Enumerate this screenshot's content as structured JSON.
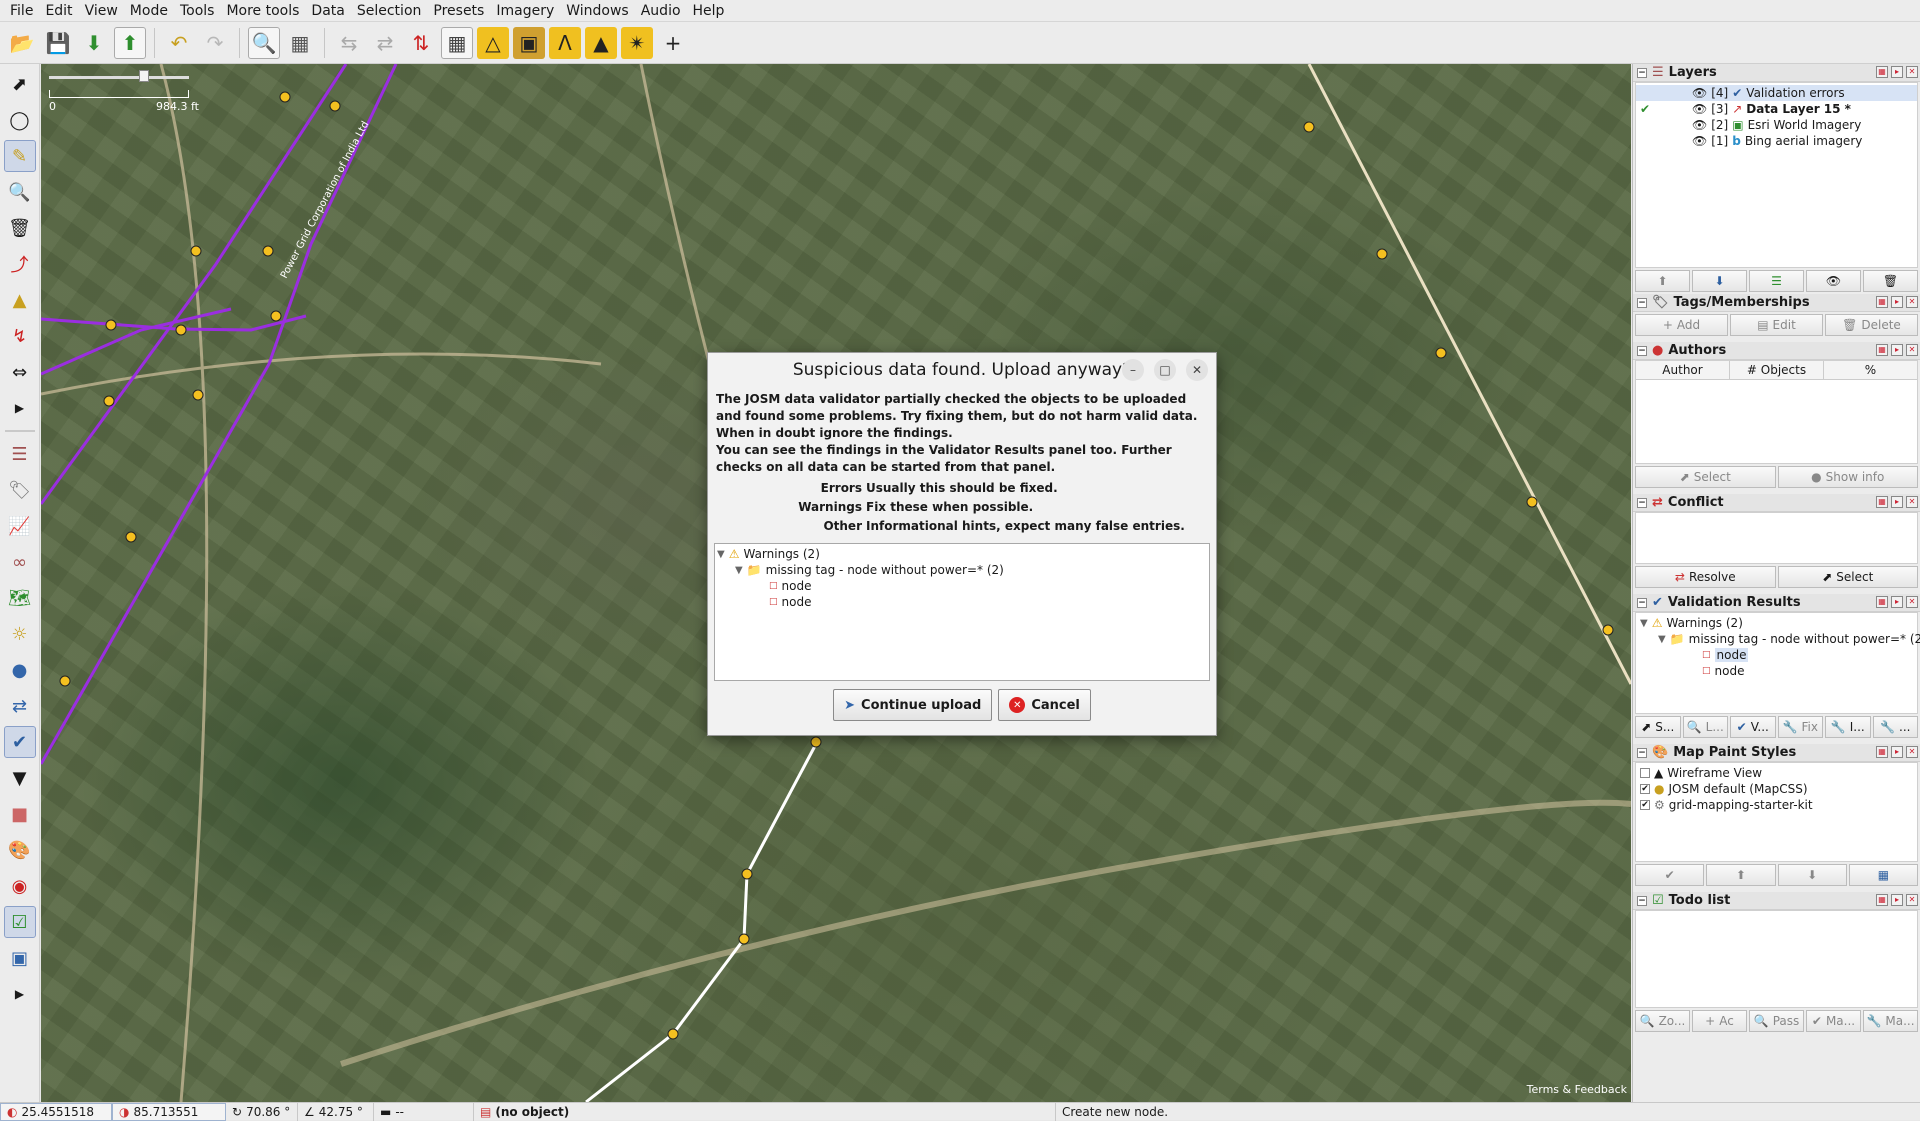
{
  "menubar": [
    "File",
    "Edit",
    "View",
    "Mode",
    "Tools",
    "More tools",
    "Data",
    "Selection",
    "Presets",
    "Imagery",
    "Windows",
    "Audio",
    "Help"
  ],
  "map": {
    "scale_zero": "0",
    "scale_distance": "984.3 ft",
    "line_label": "Power Grid Corporation of India Ltd",
    "terms": "Terms & Feedback"
  },
  "dialog": {
    "title": "Suspicious data found. Upload anyway?",
    "message_1": "The JOSM data validator partially checked the objects to be uploaded and found some problems. Try fixing them, but do not harm valid data. When in doubt ignore the findings.",
    "message_2": "You can see the findings in the Validator Results panel too. Further checks on all data can be started from that panel.",
    "legend": [
      {
        "key": "Errors",
        "value": "Usually this should be fixed."
      },
      {
        "key": "Warnings",
        "value": "Fix these when possible."
      },
      {
        "key": "Other",
        "value": "Informational hints, expect many false entries."
      }
    ],
    "tree": {
      "warnings": "Warnings (2)",
      "group": "missing tag - node without power=* (2)",
      "items": [
        "node",
        "node"
      ]
    },
    "continue_label": "Continue upload",
    "cancel_label": "Cancel"
  },
  "dock": {
    "layers": {
      "title": "Layers",
      "items": [
        {
          "index": "[4]",
          "name": "Validation errors"
        },
        {
          "index": "[3]",
          "name": "Data Layer 15 *"
        },
        {
          "index": "[2]",
          "name": "Esri World Imagery"
        },
        {
          "index": "[1]",
          "name": "Bing aerial imagery"
        }
      ]
    },
    "tags": {
      "title": "Tags/Memberships",
      "add": "Add",
      "edit": "Edit",
      "delete": "Delete"
    },
    "authors": {
      "title": "Authors",
      "col_author": "Author",
      "col_objects": "# Objects",
      "col_percent": "%",
      "select": "Select",
      "show_info": "Show info"
    },
    "conflict": {
      "title": "Conflict",
      "resolve": "Resolve",
      "select": "Select"
    },
    "validation": {
      "title": "Validation Results",
      "warnings": "Warnings (2)",
      "group": "missing tag - node without power=* (2)",
      "items": [
        "node",
        "node"
      ],
      "buttons": [
        "S...",
        "L...",
        "V...",
        "Fix",
        "I...",
        "..."
      ]
    },
    "mappaint": {
      "title": "Map Paint Styles",
      "items": [
        "Wireframe View",
        "JOSM default (MapCSS)",
        "grid-mapping-starter-kit"
      ]
    },
    "todo": {
      "title": "Todo list",
      "buttons": [
        "Zo...",
        "Ac",
        "Pass",
        "Ma...",
        "Ma..."
      ]
    }
  },
  "status": {
    "lat": "25.4551518",
    "lon": "85.713551",
    "heading": "70.86 °",
    "angle": "42.75 °",
    "length": "--",
    "object": "(no object)",
    "hint": "Create new node."
  }
}
